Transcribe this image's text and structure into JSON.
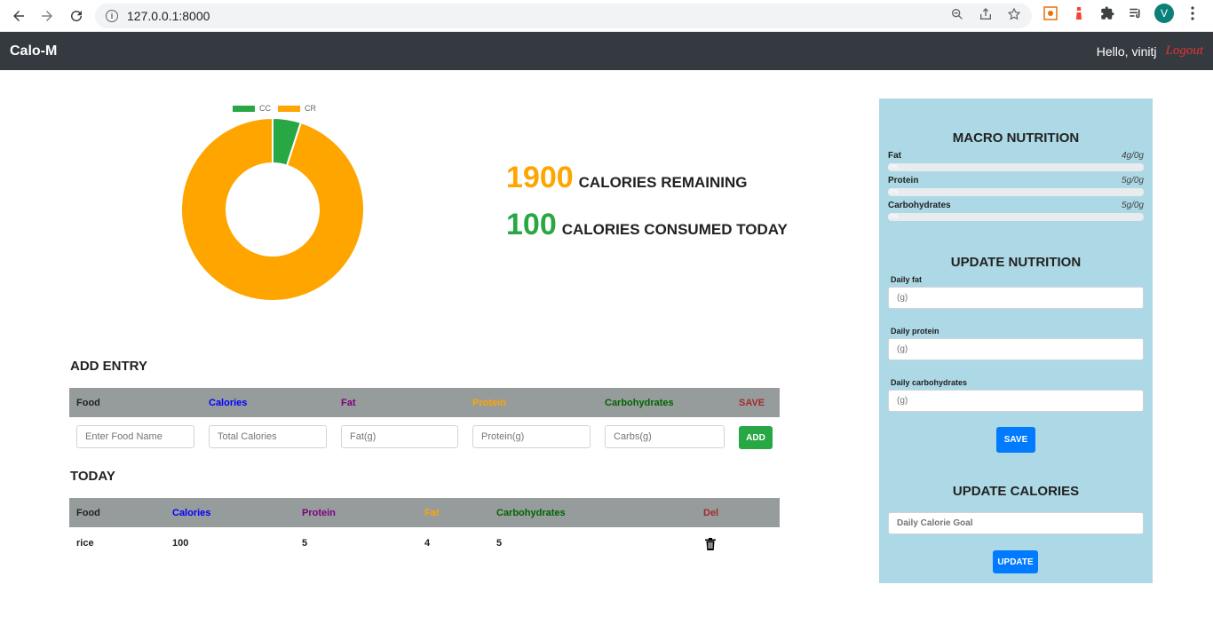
{
  "browser": {
    "url": "127.0.0.1:8000",
    "avatar_letter": "V"
  },
  "navbar": {
    "brand": "Calo-M",
    "greeting": "Hello, vinitj",
    "logout": "Logout"
  },
  "colors": {
    "consumed": "#28a745",
    "remaining": "#ffa500",
    "navbar_bg": "#343a40",
    "panel_bg": "#add8e6",
    "primary_btn": "#007bff",
    "success_btn": "#28a745"
  },
  "chart_data": {
    "type": "pie",
    "categories": [
      "CC",
      "CR"
    ],
    "values": [
      100,
      1900
    ],
    "colors": [
      "#28a745",
      "#ffa500"
    ],
    "legend": "top",
    "donut": true
  },
  "stats": {
    "remaining_value": "1900",
    "remaining_label": "CALORIES REMAINING",
    "consumed_value": "100",
    "consumed_label": "CALORIES CONSUMED TODAY"
  },
  "add_entry": {
    "title": "ADD ENTRY",
    "headers": {
      "food": "Food",
      "calories": "Calories",
      "fat": "Fat",
      "protein": "Protein",
      "carbs": "Carbohydrates",
      "save": "SAVE"
    },
    "placeholders": {
      "food": "Enter Food Name",
      "calories": "Total Calories",
      "fat": "Fat(g)",
      "protein": "Protein(g)",
      "carbs": "Carbs(g)"
    },
    "add_label": "ADD"
  },
  "today": {
    "title": "TODAY",
    "headers": {
      "food": "Food",
      "calories": "Calories",
      "protein": "Protein",
      "fat": "Fat",
      "carbs": "Carbohydrates",
      "del": "Del"
    },
    "rows": [
      {
        "food": "rice",
        "calories": "100",
        "protein": "5",
        "fat": "4",
        "carbs": "5"
      }
    ]
  },
  "macro": {
    "title": "MACRO NUTRITION",
    "items": [
      {
        "name": "Fat",
        "value": "4g/0g",
        "percent_label": "0%",
        "fraction": 0
      },
      {
        "name": "Protein",
        "value": "5g/0g",
        "percent_label": "0%",
        "fraction": 0
      },
      {
        "name": "Carbohydrates",
        "value": "5g/0g",
        "percent_label": "0%",
        "fraction": 0
      }
    ]
  },
  "update_nutrition": {
    "title": "UPDATE NUTRITION",
    "fat_label": "Daily fat",
    "protein_label": "Daily protein",
    "carbs_label": "Daily carbohydrates",
    "placeholder": "(g)",
    "save_label": "SAVE"
  },
  "update_calories": {
    "title": "UPDATE CALORIES",
    "placeholder": "Daily Calorie Goal",
    "update_label": "UPDATE"
  }
}
